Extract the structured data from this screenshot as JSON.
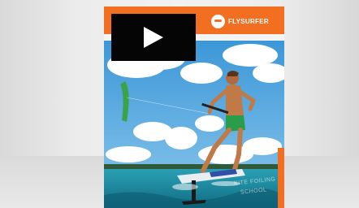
{
  "brand": {
    "name": "FLYSURFER"
  },
  "cover_text": {
    "line1": "KITE FOILING",
    "line2": "SCHOOL"
  },
  "video": {
    "play_label": "Play video"
  },
  "colors": {
    "brand_orange": "#f26f21",
    "sky_blue": "#4fa5dc",
    "sea_teal": "#1d8aa0"
  }
}
